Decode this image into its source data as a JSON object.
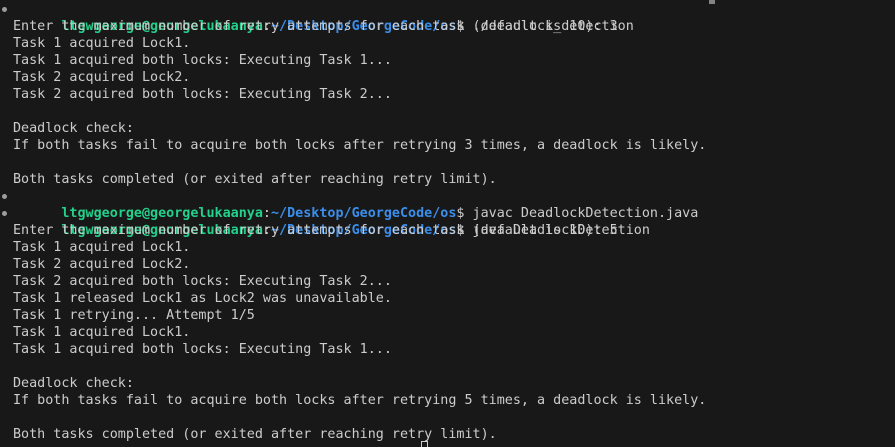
{
  "prompt": {
    "user_host": "ltgwgeorge@georgelukaanya",
    "sep": ":",
    "path": "~/Desktop/GeorgeCode/os",
    "dollar": "$"
  },
  "commands": {
    "c1": " ./deadlock_detection",
    "c2": " javac DeadlockDetection.java",
    "c3": " java DeadlockDetection"
  },
  "output": {
    "run1": [
      "Enter the maximum number of retry attempts for each task (default is 10): 3",
      "Task 1 acquired Lock1.",
      "Task 1 acquired both locks: Executing Task 1...",
      "Task 2 acquired Lock2.",
      "Task 2 acquired both locks: Executing Task 2...",
      "",
      "Deadlock check:",
      "If both tasks fail to acquire both locks after retrying 3 times, a deadlock is likely.",
      "",
      "Both tasks completed (or exited after reaching retry limit)."
    ],
    "run2": [
      "Enter the maximum number of retry attempts for each task (default is 10): 5",
      "Task 1 acquired Lock1.",
      "Task 2 acquired Lock2.",
      "Task 2 acquired both locks: Executing Task 2...",
      "Task 1 released Lock1 as Lock2 was unavailable.",
      "Task 1 retrying... Attempt 1/5",
      "Task 1 acquired Lock1.",
      "Task 1 acquired both locks: Executing Task 1...",
      "",
      "Deadlock check:",
      "If both tasks fail to acquire both locks after retrying 5 times, a deadlock is likely.",
      "",
      "Both tasks completed (or exited after reaching retry limit)."
    ]
  },
  "colors": {
    "background": "#181818",
    "text": "#cccccc",
    "prompt_user": "#23d18b",
    "prompt_path": "#3b8eea"
  }
}
